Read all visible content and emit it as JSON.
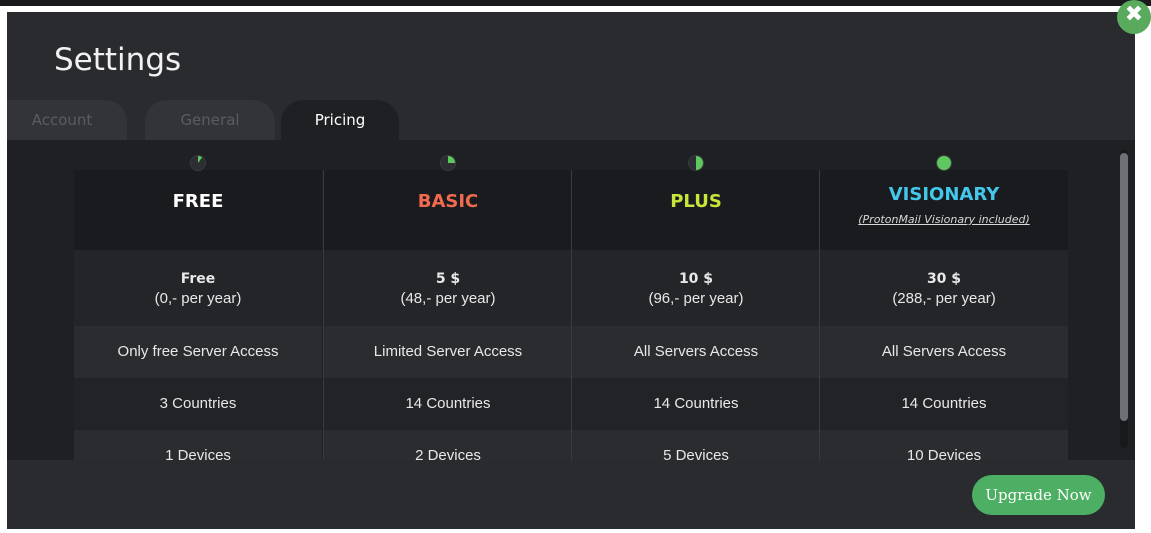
{
  "dialog": {
    "title": "Settings",
    "close_symbol": "✖"
  },
  "tabs": [
    {
      "label": "Account",
      "active": false
    },
    {
      "label": "General",
      "active": false
    },
    {
      "label": "Pricing",
      "active": true
    }
  ],
  "plans": [
    {
      "name": "FREE",
      "name_color": "#ffffff",
      "indicator_fill": 0.1,
      "price": "Free",
      "price_sub": "(0,- per year)",
      "server_access": "Only free Server Access",
      "countries": "3 Countries",
      "devices": "1 Devices"
    },
    {
      "name": "BASIC",
      "name_color": "#ef6a4f",
      "indicator_fill": 0.25,
      "price": "5 $",
      "price_sub": "(48,- per year)",
      "server_access": "Limited Server Access",
      "countries": "14 Countries",
      "devices": "2 Devices"
    },
    {
      "name": "PLUS",
      "name_color": "#c6e63a",
      "indicator_fill": 0.5,
      "price": "10 $",
      "price_sub": "(96,- per year)",
      "server_access": "All Servers Access",
      "countries": "14 Countries",
      "devices": "5 Devices"
    },
    {
      "name": "VISIONARY",
      "name_color": "#43c8ec",
      "note": "(ProtonMail Visionary included)",
      "indicator_fill": 1.0,
      "price": "30 $",
      "price_sub": "(288,- per year)",
      "server_access": "All Servers Access",
      "countries": "14 Countries",
      "devices": "10 Devices"
    }
  ],
  "footer": {
    "upgrade_label": "Upgrade Now"
  },
  "colors": {
    "accent_green": "#4caf63",
    "indicator_green": "#5fc95f"
  },
  "icons": {
    "close": "close-icon",
    "plan_indicator": "pie-indicator-icon"
  }
}
